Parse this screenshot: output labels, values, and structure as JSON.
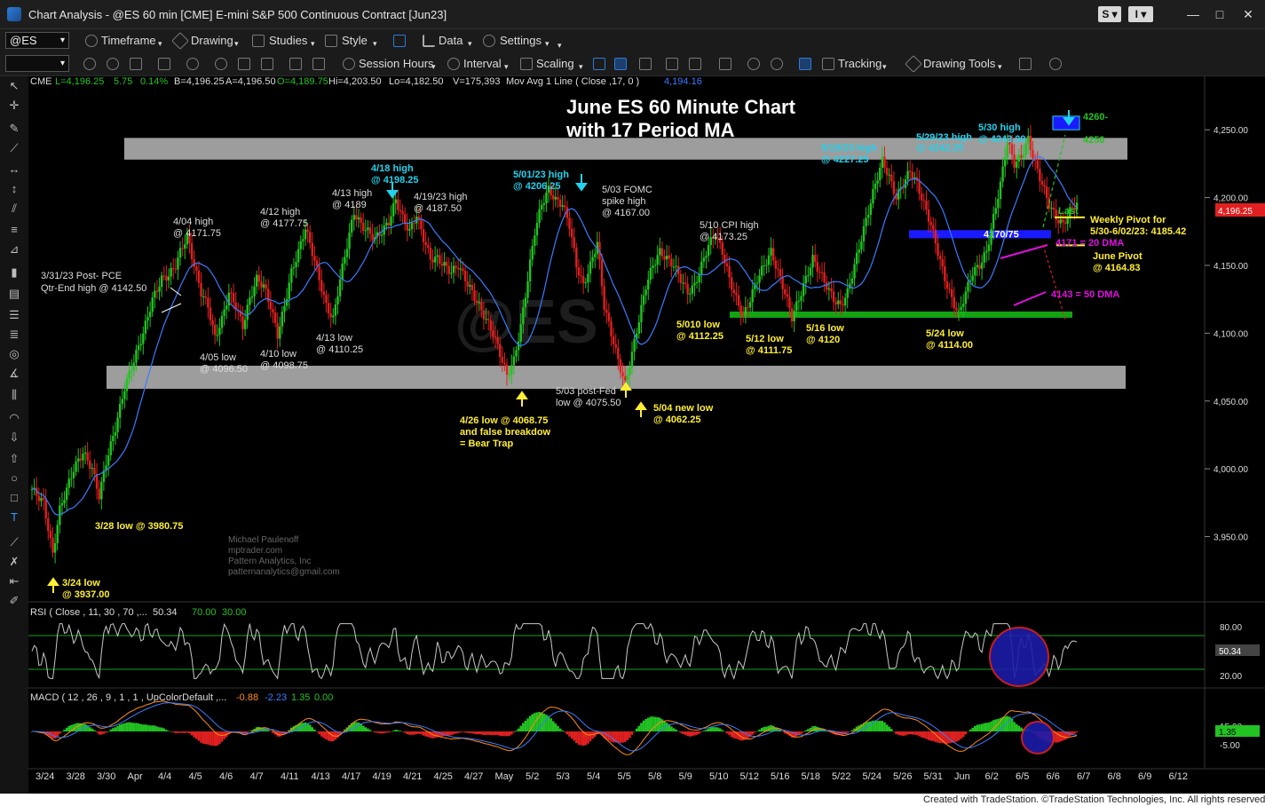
{
  "window": {
    "title": "Chart Analysis - @ES 60 min [CME] E-mini S&P 500 Continuous Contract [Jun23]",
    "btn_s": "S",
    "btn_i": "I",
    "minimize": "—",
    "maximize": "□",
    "close": "✕"
  },
  "toolbar1": {
    "symbol": "@ES",
    "timeframe": "Timeframe",
    "drawing": "Drawing",
    "studies": "Studies",
    "style": "Style",
    "data": "Data",
    "settings": "Settings"
  },
  "toolbar2": {
    "session_hours": "Session Hours",
    "interval": "Interval",
    "scaling": "Scaling",
    "tracking": "Tracking",
    "drawing_tools": "Drawing Tools"
  },
  "price_header": {
    "exchange": "CME",
    "last": "L=4,196.25",
    "change": "5.75",
    "pct": "0.14%",
    "bid": "B=4,196.25",
    "ask": "A=4,196.50",
    "open": "O=4,189.75",
    "high": "Hi=4,203.50",
    "low": "Lo=4,182.50",
    "volume": "V=175,393",
    "ma_label": "Mov Avg 1 Line ( Close ,17, 0 )",
    "ma_value": "4,194.16"
  },
  "rsi_header": {
    "label": "RSI ( Close , 11, 30 , 70 ,...",
    "v1": "50.34",
    "v2": "70.00",
    "v3": "30.00"
  },
  "macd_header": {
    "label": "MACD ( 12 , 26 , 9 , 1 , 1 , UpColorDefault ,...",
    "v1": "-0.88",
    "v2": "-2.23",
    "v3": "1.35",
    "v4": "0.00"
  },
  "rsi_axis": [
    "80.00",
    "20.00"
  ],
  "rsi_last": "50.34",
  "macd_axis": [
    "15.00",
    "-5.00"
  ],
  "macd_last": "1.35",
  "last_price_tag": "4,196.25",
  "watermark": "@ES",
  "chart_title": [
    "June ES 60 Minute Chart",
    "with 17 Period MA"
  ],
  "credit": [
    "Michael Paulenoff",
    "mptrader.com",
    "Pattern Analytics, Inc",
    "patternanalytics@gmail.com"
  ],
  "footer": "Created with TradeStation. ©TradeStation Technologies, Inc. All rights reserved.",
  "colors": {
    "up": "#22c322",
    "down": "#e02020",
    "ma": "#3a7bff",
    "cyan": "#22d3ee",
    "yellow": "#ffee33",
    "magenta": "#e010e0",
    "band": "#b8b8b8",
    "green_line": "#13a313",
    "blue_zone": "#1a1aff"
  },
  "chart_data": {
    "type": "candlestick",
    "instrument": "@ES 60 min",
    "ylim": [
      3915,
      4275
    ],
    "y_ticks": [
      "4,250.00",
      "4,200.00",
      "4,150.00",
      "4,100.00",
      "4,050.00",
      "4,000.00",
      "3,950.00"
    ],
    "x_ticks": [
      "3/24",
      "3/28",
      "3/30",
      "Apr",
      "4/4",
      "4/5",
      "4/6",
      "4/7",
      "4/11",
      "4/13",
      "4/17",
      "4/19",
      "4/21",
      "4/25",
      "4/27",
      "May",
      "5/2",
      "5/3",
      "5/4",
      "5/5",
      "5/8",
      "5/9",
      "5/10",
      "5/12",
      "5/16",
      "5/18",
      "5/22",
      "5/24",
      "5/26",
      "5/31",
      "Jun",
      "6/2",
      "6/5",
      "6/6",
      "6/7",
      "6/8",
      "6/9",
      "6/12"
    ],
    "price_path": [
      [
        0,
        3985
      ],
      [
        5,
        3975
      ],
      [
        9,
        3937
      ],
      [
        12,
        3970
      ],
      [
        16,
        3990
      ],
      [
        18,
        4000
      ],
      [
        22,
        4012
      ],
      [
        26,
        4000
      ],
      [
        29,
        3980
      ],
      [
        32,
        4005
      ],
      [
        36,
        4030
      ],
      [
        40,
        4060
      ],
      [
        44,
        4080
      ],
      [
        48,
        4100
      ],
      [
        52,
        4125
      ],
      [
        56,
        4140
      ],
      [
        59,
        4142.5
      ],
      [
        62,
        4150
      ],
      [
        64,
        4160
      ],
      [
        67,
        4171.75
      ],
      [
        70,
        4150
      ],
      [
        73,
        4130
      ],
      [
        76,
        4120
      ],
      [
        79,
        4096.5
      ],
      [
        82,
        4110
      ],
      [
        85,
        4130
      ],
      [
        88,
        4120
      ],
      [
        91,
        4105
      ],
      [
        94,
        4125
      ],
      [
        97,
        4140
      ],
      [
        100,
        4135
      ],
      [
        103,
        4120
      ],
      [
        106,
        4098.75
      ],
      [
        109,
        4120
      ],
      [
        112,
        4145
      ],
      [
        115,
        4160
      ],
      [
        118,
        4177.75
      ],
      [
        121,
        4160
      ],
      [
        124,
        4140
      ],
      [
        127,
        4120
      ],
      [
        130,
        4110.25
      ],
      [
        133,
        4140
      ],
      [
        136,
        4165
      ],
      [
        139,
        4189
      ],
      [
        142,
        4180
      ],
      [
        145,
        4175
      ],
      [
        148,
        4170
      ],
      [
        151,
        4175
      ],
      [
        154,
        4182
      ],
      [
        157,
        4198.25
      ],
      [
        160,
        4185
      ],
      [
        163,
        4175
      ],
      [
        166,
        4187.5
      ],
      [
        169,
        4170
      ],
      [
        172,
        4155
      ],
      [
        175,
        4155
      ],
      [
        178,
        4150
      ],
      [
        181,
        4145
      ],
      [
        184,
        4150
      ],
      [
        187,
        4140
      ],
      [
        190,
        4130
      ],
      [
        193,
        4120
      ],
      [
        196,
        4110
      ],
      [
        199,
        4100
      ],
      [
        202,
        4085
      ],
      [
        205,
        4068.75
      ],
      [
        208,
        4080
      ],
      [
        211,
        4105
      ],
      [
        214,
        4140
      ],
      [
        217,
        4175
      ],
      [
        220,
        4195
      ],
      [
        223,
        4206.25
      ],
      [
        226,
        4198
      ],
      [
        229,
        4195
      ],
      [
        232,
        4180
      ],
      [
        235,
        4150
      ],
      [
        238,
        4135
      ],
      [
        241,
        4150
      ],
      [
        244,
        4167
      ],
      [
        247,
        4120
      ],
      [
        250,
        4100
      ],
      [
        253,
        4080
      ],
      [
        256,
        4062.25
      ],
      [
        259,
        4085
      ],
      [
        262,
        4110
      ],
      [
        265,
        4135
      ],
      [
        268,
        4150
      ],
      [
        271,
        4160
      ],
      [
        274,
        4155
      ],
      [
        277,
        4150
      ],
      [
        280,
        4140
      ],
      [
        283,
        4130
      ],
      [
        286,
        4135
      ],
      [
        289,
        4150
      ],
      [
        292,
        4165
      ],
      [
        295,
        4173.25
      ],
      [
        298,
        4160
      ],
      [
        301,
        4140
      ],
      [
        304,
        4125
      ],
      [
        307,
        4112.25
      ],
      [
        310,
        4125
      ],
      [
        313,
        4140
      ],
      [
        316,
        4150
      ],
      [
        319,
        4160
      ],
      [
        322,
        4145
      ],
      [
        325,
        4130
      ],
      [
        328,
        4111.75
      ],
      [
        331,
        4125
      ],
      [
        334,
        4140
      ],
      [
        337,
        4155
      ],
      [
        340,
        4145
      ],
      [
        343,
        4135
      ],
      [
        346,
        4125
      ],
      [
        349,
        4120
      ],
      [
        352,
        4130
      ],
      [
        355,
        4150
      ],
      [
        358,
        4170
      ],
      [
        361,
        4190
      ],
      [
        364,
        4210
      ],
      [
        367,
        4227.25
      ],
      [
        370,
        4215
      ],
      [
        373,
        4200
      ],
      [
        376,
        4210
      ],
      [
        379,
        4220
      ],
      [
        382,
        4210
      ],
      [
        385,
        4195
      ],
      [
        388,
        4180
      ],
      [
        391,
        4160
      ],
      [
        394,
        4140
      ],
      [
        397,
        4125
      ],
      [
        400,
        4114
      ],
      [
        403,
        4130
      ],
      [
        406,
        4145
      ],
      [
        409,
        4150
      ],
      [
        412,
        4160
      ],
      [
        415,
        4185
      ],
      [
        418,
        4210
      ],
      [
        421,
        4242.25
      ],
      [
        424,
        4225
      ],
      [
        427,
        4230
      ],
      [
        430,
        4243
      ],
      [
        433,
        4225
      ],
      [
        436,
        4210
      ],
      [
        439,
        4195
      ],
      [
        442,
        4185
      ],
      [
        445,
        4180
      ],
      [
        448,
        4190
      ],
      [
        451,
        4196.25
      ]
    ],
    "annotations_white": [
      "3/31/23 Post- PCE",
      "Qtr-End high @ 4142.50",
      "4/04 high",
      "@ 4171.75",
      "4/12 high",
      "@ 4177.75",
      "4/13 high",
      "@ 4189",
      "4/19/23 high",
      "@ 4187.50",
      "5/03 FOMC",
      "spike high",
      "@ 4167.00",
      "5/10 CPI high",
      "@ 4173.25",
      "4/05 low",
      "@ 4096.50",
      "4/10 low",
      "@ 4098.75",
      "4/13 low",
      "@ 4110.25",
      "5/03 post-Fed",
      "low @ 4075.50"
    ],
    "annotations_cyan": [
      "4/18 high",
      "@ 4198.25",
      "5/01/23 high",
      "@ 4206.25",
      "5/19/23 high",
      "@ 4227.25",
      "5/29/23 high",
      "@ 4242.25",
      "5/30 high",
      "@ 4243.00"
    ],
    "annotations_yellow": [
      "3/24 low",
      "@ 3937.00",
      "3/28 low @ 3980.75",
      "4/26 low @ 4068.75",
      "and false breakdow",
      "= Bear Trap",
      "5/04 new low",
      "@ 4062.25",
      "5/010 low",
      "@ 4112.25",
      "5/12 low",
      "@ 4111.75",
      "5/16 low",
      "@ 4120",
      "5/24 low",
      "@ 4114.00",
      "Weekly Pivot for",
      "5/30-6/02/23: 4185.42",
      "June Pivot",
      "@ 4164.83",
      "4260-",
      "4250"
    ],
    "annotations_green": [
      "Last"
    ],
    "annotations_magenta": [
      "4171 = 20 DMA",
      "4143 = 50 DMA"
    ],
    "zone_label": "4170/75",
    "levels": {
      "upper_band": [
        4228,
        4244
      ],
      "lower_band": [
        4059,
        4076
      ],
      "support_line": 4114,
      "blue_zone": [
        4170,
        4176
      ],
      "target_box": [
        4250,
        4260
      ],
      "weekly_pivot": 4185.42,
      "june_pivot": 4164.83,
      "dma20": 4171,
      "dma50": 4143
    }
  }
}
